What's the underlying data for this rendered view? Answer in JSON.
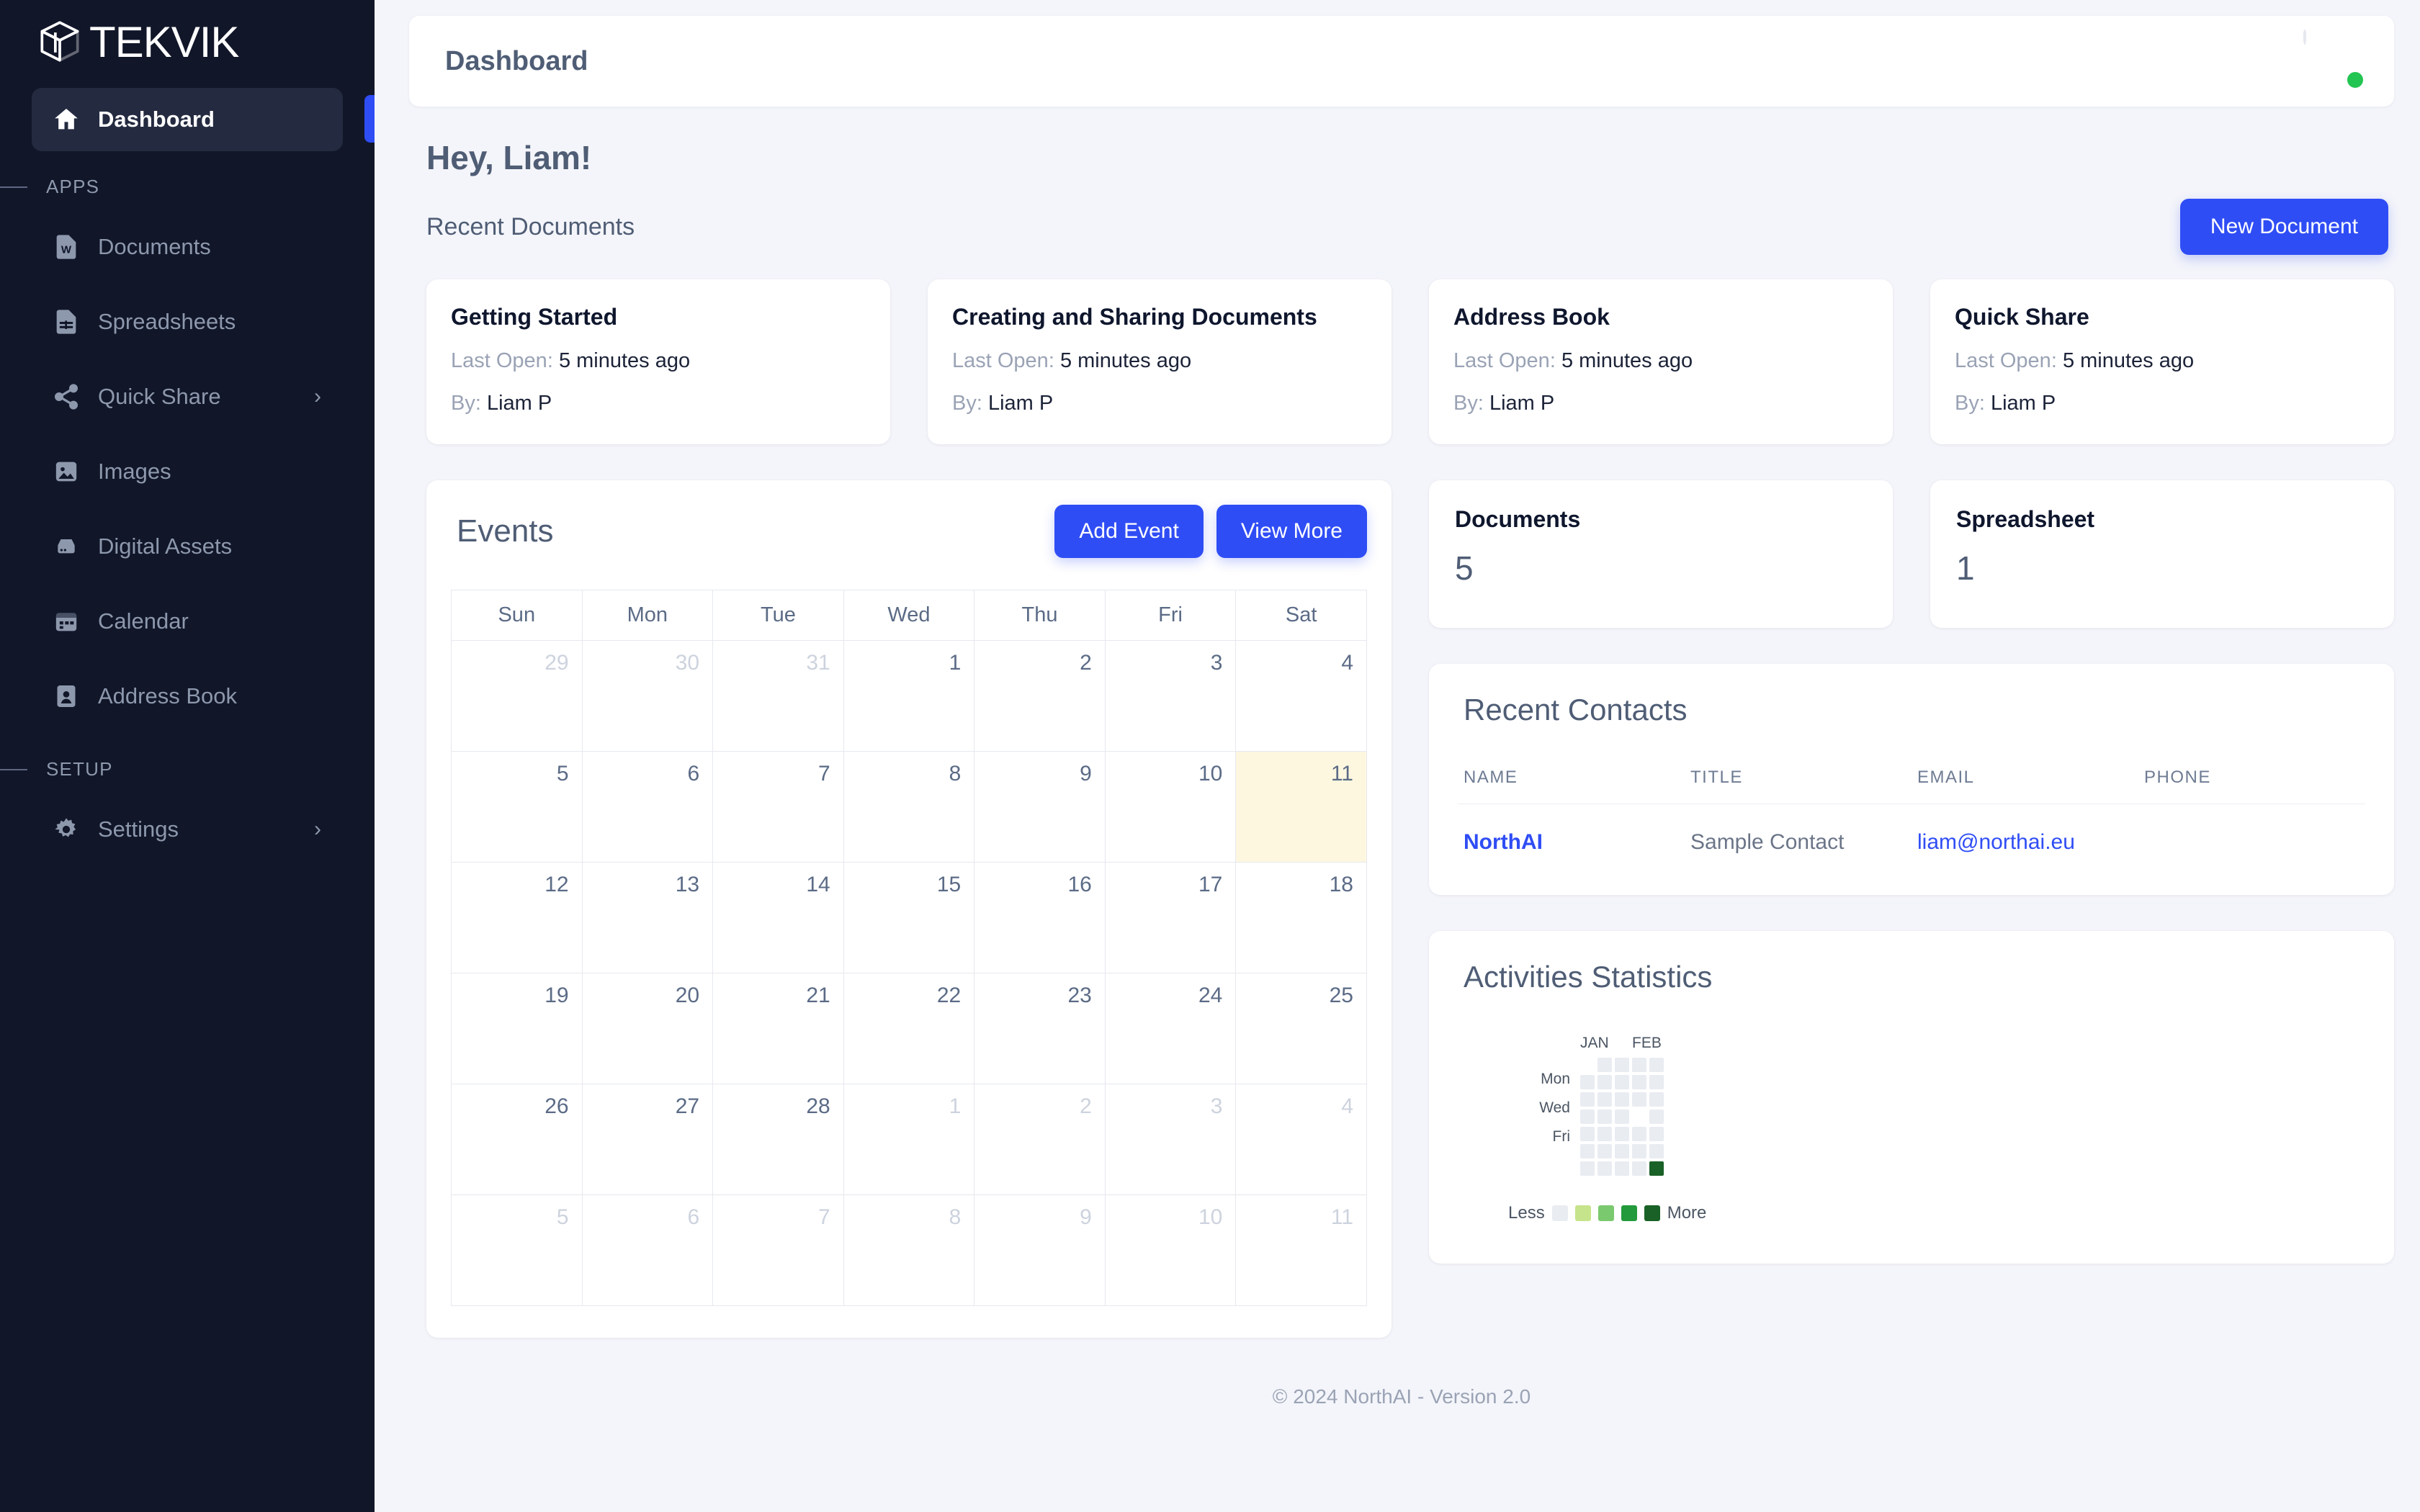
{
  "brand": {
    "name": "TEKVIK",
    "logo_icon": "tekvik-cube-logo-icon"
  },
  "sidebar": {
    "primary": [
      {
        "label": "Dashboard",
        "icon": "home-icon",
        "active": true
      }
    ],
    "sections": [
      {
        "title": "APPS",
        "items": [
          {
            "label": "Documents",
            "icon": "word-document-icon",
            "chevron": ""
          },
          {
            "label": "Spreadsheets",
            "icon": "spreadsheet-icon",
            "chevron": ""
          },
          {
            "label": "Quick Share",
            "icon": "share-icon",
            "chevron": "›"
          },
          {
            "label": "Images",
            "icon": "image-icon",
            "chevron": ""
          },
          {
            "label": "Digital Assets",
            "icon": "digital-assets-icon",
            "chevron": ""
          },
          {
            "label": "Calendar",
            "icon": "calendar-icon",
            "chevron": ""
          },
          {
            "label": "Address Book",
            "icon": "address-book-icon",
            "chevron": ""
          }
        ]
      },
      {
        "title": "SETUP",
        "items": [
          {
            "label": "Settings",
            "icon": "gear-icon",
            "chevron": "›"
          }
        ]
      }
    ]
  },
  "topbar": {
    "title": "Dashboard",
    "avatar_icon": "user-avatar",
    "status": "online"
  },
  "page": {
    "greeting": "Hey, Liam!",
    "recent_documents_label": "Recent Documents",
    "new_document_label": "New Document"
  },
  "recent_documents": [
    {
      "title": "Getting Started",
      "last_open_label": "Last Open:",
      "last_open": "5 minutes ago",
      "by_label": "By:",
      "by": "Liam P"
    },
    {
      "title": "Creating and Sharing Documents",
      "last_open_label": "Last Open:",
      "last_open": "5 minutes ago",
      "by_label": "By:",
      "by": "Liam P"
    },
    {
      "title": "Address Book",
      "last_open_label": "Last Open:",
      "last_open": "5 minutes ago",
      "by_label": "By:",
      "by": "Liam P"
    },
    {
      "title": "Quick Share",
      "last_open_label": "Last Open:",
      "last_open": "5 minutes ago",
      "by_label": "By:",
      "by": "Liam P"
    }
  ],
  "events": {
    "title": "Events",
    "add_event_label": "Add Event",
    "view_more_label": "View More",
    "weekdays": [
      "Sun",
      "Mon",
      "Tue",
      "Wed",
      "Thu",
      "Fri",
      "Sat"
    ],
    "weeks": [
      [
        {
          "d": "29",
          "m": true
        },
        {
          "d": "30",
          "m": true
        },
        {
          "d": "31",
          "m": true
        },
        {
          "d": "1"
        },
        {
          "d": "2"
        },
        {
          "d": "3"
        },
        {
          "d": "4"
        }
      ],
      [
        {
          "d": "5"
        },
        {
          "d": "6"
        },
        {
          "d": "7"
        },
        {
          "d": "8"
        },
        {
          "d": "9"
        },
        {
          "d": "10"
        },
        {
          "d": "11",
          "today": true
        }
      ],
      [
        {
          "d": "12"
        },
        {
          "d": "13"
        },
        {
          "d": "14"
        },
        {
          "d": "15"
        },
        {
          "d": "16"
        },
        {
          "d": "17"
        },
        {
          "d": "18"
        }
      ],
      [
        {
          "d": "19"
        },
        {
          "d": "20"
        },
        {
          "d": "21"
        },
        {
          "d": "22"
        },
        {
          "d": "23"
        },
        {
          "d": "24"
        },
        {
          "d": "25"
        }
      ],
      [
        {
          "d": "26"
        },
        {
          "d": "27"
        },
        {
          "d": "28"
        },
        {
          "d": "1",
          "m": true
        },
        {
          "d": "2",
          "m": true
        },
        {
          "d": "3",
          "m": true
        },
        {
          "d": "4",
          "m": true
        }
      ],
      [
        {
          "d": "5",
          "m": true
        },
        {
          "d": "6",
          "m": true
        },
        {
          "d": "7",
          "m": true
        },
        {
          "d": "8",
          "m": true
        },
        {
          "d": "9",
          "m": true
        },
        {
          "d": "10",
          "m": true
        },
        {
          "d": "11",
          "m": true
        }
      ]
    ]
  },
  "stats": [
    {
      "label": "Documents",
      "value": "5"
    },
    {
      "label": "Spreadsheet",
      "value": "1"
    }
  ],
  "contacts": {
    "title": "Recent Contacts",
    "columns": [
      "NAME",
      "TITLE",
      "EMAIL",
      "PHONE"
    ],
    "rows": [
      {
        "name": "NorthAI",
        "title": "Sample Contact",
        "email": "liam@northai.eu",
        "phone": ""
      }
    ]
  },
  "activities": {
    "title": "Activities Statistics",
    "less_label": "Less",
    "more_label": "More",
    "months": [
      "JAN",
      "FEB"
    ],
    "day_labels": [
      "",
      "Mon",
      "",
      "Wed",
      "",
      "Fri",
      ""
    ],
    "legend_colors": [
      "#e9ecf1",
      "#c6e48b",
      "#7bc96f",
      "#239a3b",
      "#196127"
    ]
  },
  "chart_data": {
    "type": "heatmap",
    "title": "Activities Statistics",
    "months": [
      "JAN",
      "FEB"
    ],
    "day_labels": [
      "",
      "Mon",
      "",
      "Wed",
      "",
      "Fri",
      ""
    ],
    "legend": {
      "less": "Less",
      "more": "More",
      "colors": [
        "#e9ecf1",
        "#c6e48b",
        "#7bc96f",
        "#239a3b",
        "#196127"
      ]
    },
    "columns": 5,
    "rows": 7,
    "cells": [
      [
        null,
        0,
        0,
        0,
        0,
        0,
        0
      ],
      [
        0,
        0,
        0,
        0,
        0,
        0,
        0
      ],
      [
        0,
        0,
        0,
        0,
        0,
        0,
        0
      ],
      [
        0,
        0,
        0,
        null,
        0,
        0,
        0
      ],
      [
        0,
        0,
        0,
        0,
        0,
        0,
        4
      ]
    ]
  },
  "footer": {
    "text": "© 2024 NorthAI - Version 2.0"
  }
}
